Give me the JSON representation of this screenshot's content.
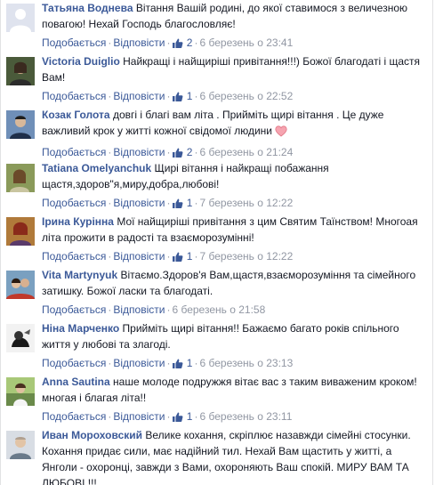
{
  "actions": {
    "like_label": "Подобається",
    "reply_label": "Відповісти"
  },
  "comments": [
    {
      "author": "Татьяна Воднева",
      "text": "Вітання Вашій родині, до якої ставимося з величезною повагою! Нехай Господь благословляє!",
      "likes": "2",
      "time": "6 березень о 23:41"
    },
    {
      "author": "Victoria Duiglio",
      "text": "Найкращі і найщиріші привітання!!!) Божої благодаті і щастя Вам!",
      "likes": "1",
      "time": "6 березень о 22:52"
    },
    {
      "author": "Козак Голота",
      "text": "довгі і благі вам літа . Прийміть щирі вітання . Це дуже важливий крок у житті кожної свідомої людини",
      "likes": "2",
      "time": "6 березень о 21:24"
    },
    {
      "author": "Tatiana Omelyanchuk",
      "text": "Щирі вітання і найкращі побажання щастя,здоров\"я,миру,добра,любові!",
      "likes": "1",
      "time": "7 березень о 12:22"
    },
    {
      "author": "Ірина Курінна",
      "text": "Мої найщиріші привітання з цим Святим Таїнством! Многоая літа прожити в радості та взаєморозумінні!",
      "likes": "1",
      "time": "7 березень о 12:22"
    },
    {
      "author": "Vita Martynyuk",
      "text": "Вітаємо.Здоров'я Вам,щастя,взаєморозуміння та сімейного затишку. Божої ласки та благодаті.",
      "likes": "",
      "time": "6 березень о 21:58"
    },
    {
      "author": "Ніна Марченко",
      "text": "Прийміть щирі вітання!! Бажаємо багато років спільного життя у любові та злагоді.",
      "likes": "1",
      "time": "6 березень о 23:13"
    },
    {
      "author": "Anna Sautina",
      "text": "наше молоде подружжя вітає вас з таким виваженим кроком! многая і благая літа!!",
      "likes": "1",
      "time": "6 березень о 23:11"
    },
    {
      "author": "Иван Мороховский",
      "text": "Велике кохання, скріплює назавжди сімейні стосунки. Кохання придає сили, має надійний тил. Нехай Вам щастить у житті, а Янголи - охоронці, завжди з Вами, охороняють Ваш спокій. МИРУ ВАМ ТА ЛЮБОВІ !!!",
      "likes": "",
      "time": ""
    }
  ]
}
